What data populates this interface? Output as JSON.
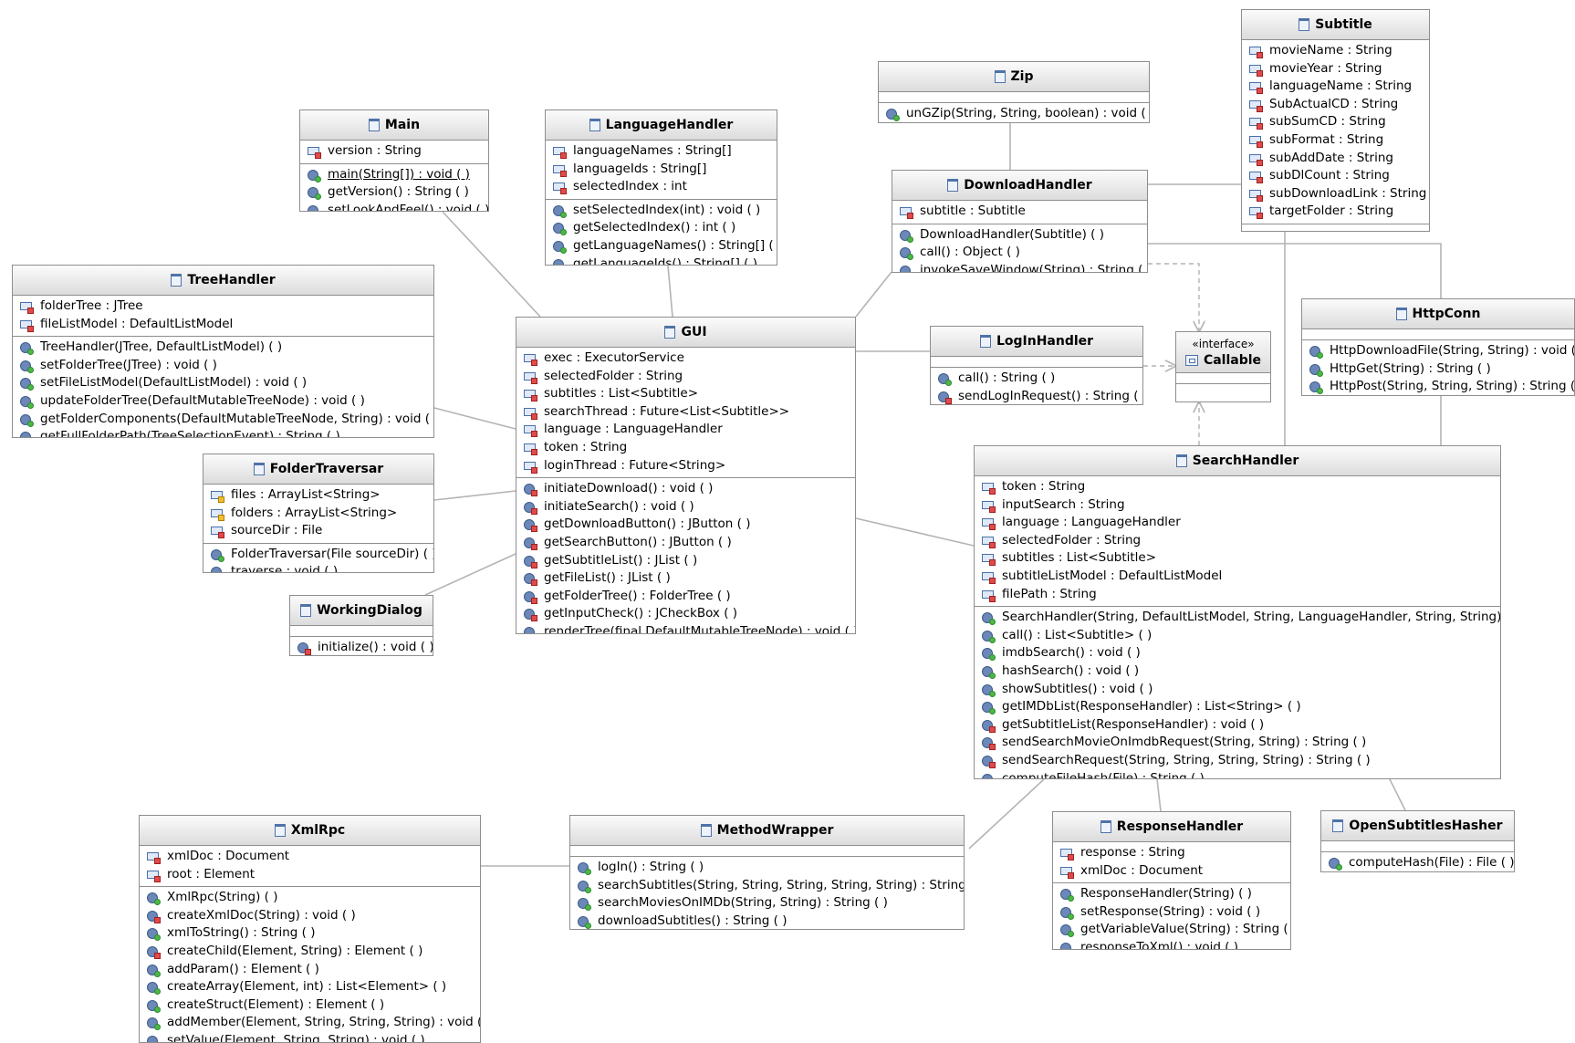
{
  "classes": [
    {
      "id": "main",
      "name": "Main",
      "fields": [
        {
          "text": "version : String",
          "vis": "priv"
        }
      ],
      "methods": [
        {
          "text": "main(String[]) : void ( )",
          "vis": "pub",
          "static": true
        },
        {
          "text": "getVersion() : String ( )",
          "vis": "pub"
        },
        {
          "text": "setLookAndFeel() : void ( )",
          "vis": "priv"
        }
      ]
    },
    {
      "id": "languagehandler",
      "name": "LanguageHandler",
      "fields": [
        {
          "text": "languageNames : String[]",
          "vis": "priv"
        },
        {
          "text": "languageIds : String[]",
          "vis": "priv"
        },
        {
          "text": "selectedIndex : int",
          "vis": "priv"
        }
      ],
      "methods": [
        {
          "text": "setSelectedIndex(int) : void ( )",
          "vis": "pub"
        },
        {
          "text": "getSelectedIndex() : int ( )",
          "vis": "pub"
        },
        {
          "text": "getLanguageNames() : String[] ( )",
          "vis": "pub"
        },
        {
          "text": "getLanguageIds() : String[] ( )",
          "vis": "pub"
        }
      ]
    },
    {
      "id": "zip",
      "name": "Zip",
      "fields": [],
      "methods": [
        {
          "text": "unGZip(String, String, boolean) : void ( )",
          "vis": "pub"
        }
      ]
    },
    {
      "id": "subtitle",
      "name": "Subtitle",
      "fields": [
        {
          "text": "movieName : String",
          "vis": "priv"
        },
        {
          "text": "movieYear : String",
          "vis": "priv"
        },
        {
          "text": "languageName : String",
          "vis": "priv"
        },
        {
          "text": "SubActualCD : String",
          "vis": "priv"
        },
        {
          "text": "subSumCD : String",
          "vis": "priv"
        },
        {
          "text": "subFormat : String",
          "vis": "priv"
        },
        {
          "text": "subAddDate : String",
          "vis": "priv"
        },
        {
          "text": "subDlCount : String",
          "vis": "priv"
        },
        {
          "text": "subDownloadLink : String",
          "vis": "priv"
        },
        {
          "text": "targetFolder : String",
          "vis": "priv"
        }
      ],
      "methods": []
    },
    {
      "id": "downloadhandler",
      "name": "DownloadHandler",
      "fields": [
        {
          "text": "subtitle : Subtitle",
          "vis": "priv"
        }
      ],
      "methods": [
        {
          "text": "DownloadHandler(Subtitle) ( )",
          "vis": "pub"
        },
        {
          "text": "call() : Object ( )",
          "vis": "pub"
        },
        {
          "text": "invokeSaveWindow(String) : String ( )",
          "vis": "priv"
        }
      ]
    },
    {
      "id": "treehandler",
      "name": "TreeHandler",
      "fields": [
        {
          "text": "folderTree : JTree",
          "vis": "priv"
        },
        {
          "text": "fileListModel : DefaultListModel",
          "vis": "priv"
        }
      ],
      "methods": [
        {
          "text": "TreeHandler(JTree, DefaultListModel) ( )",
          "vis": "pub"
        },
        {
          "text": "setFolderTree(JTree) : void ( )",
          "vis": "pub"
        },
        {
          "text": "setFileListModel(DefaultListModel) : void ( )",
          "vis": "pub"
        },
        {
          "text": "updateFolderTree(DefaultMutableTreeNode) : void ( )",
          "vis": "pub"
        },
        {
          "text": "getFolderComponents(DefaultMutableTreeNode, String) : void ( )",
          "vis": "pub"
        },
        {
          "text": "getFullFolderPath(TreeSelectionEvent) : String ( )",
          "vis": "pub"
        }
      ]
    },
    {
      "id": "gui",
      "name": "GUI",
      "fields": [
        {
          "text": "exec : ExecutorService",
          "vis": "priv"
        },
        {
          "text": "selectedFolder : String",
          "vis": "priv"
        },
        {
          "text": "subtitles : List<Subtitle>",
          "vis": "priv"
        },
        {
          "text": "searchThread : Future<List<Subtitle>>",
          "vis": "priv"
        },
        {
          "text": "language : LanguageHandler",
          "vis": "priv"
        },
        {
          "text": "token : String",
          "vis": "priv"
        },
        {
          "text": "loginThread : Future<String>",
          "vis": "priv"
        }
      ],
      "methods": [
        {
          "text": "initiateDownload() : void ( )",
          "vis": "priv"
        },
        {
          "text": "initiateSearch() : void ( )",
          "vis": "priv"
        },
        {
          "text": "getDownloadButton() : JButton ( )",
          "vis": "priv"
        },
        {
          "text": "getSearchButton() : JButton ( )",
          "vis": "priv"
        },
        {
          "text": "getSubtitleList() : JList ( )",
          "vis": "priv"
        },
        {
          "text": "getFileList() : JList ( )",
          "vis": "priv"
        },
        {
          "text": "getFolderTree() : FolderTree ( )",
          "vis": "priv"
        },
        {
          "text": "getInputCheck() : JCheckBox ( )",
          "vis": "priv"
        },
        {
          "text": "renderTree(final DefaultMutableTreeNode) : void ( )",
          "vis": "priv"
        }
      ]
    },
    {
      "id": "loginhandler",
      "name": "LogInHandler",
      "fields": [],
      "methods": [
        {
          "text": "call() : String ( )",
          "vis": "pub"
        },
        {
          "text": "sendLogInRequest() : String ( )",
          "vis": "priv"
        }
      ]
    },
    {
      "id": "callable",
      "name": "Callable",
      "stereotype": "«interface»",
      "fields": [],
      "methods": []
    },
    {
      "id": "httpconn",
      "name": "HttpConn",
      "fields": [],
      "methods": [
        {
          "text": "HttpDownloadFile(String, String) : void ( )",
          "vis": "pub"
        },
        {
          "text": "HttpGet(String) : String ( )",
          "vis": "pub"
        },
        {
          "text": "HttpPost(String, String, String) : String ( )",
          "vis": "pub"
        }
      ]
    },
    {
      "id": "foldertraversar",
      "name": "FolderTraversar",
      "fields": [
        {
          "text": "files : ArrayList<String>",
          "vis": "prot"
        },
        {
          "text": "folders : ArrayList<String>",
          "vis": "prot"
        },
        {
          "text": "sourceDir : File",
          "vis": "priv"
        }
      ],
      "methods": [
        {
          "text": "FolderTraversar(File sourceDir) ( )",
          "vis": "pub"
        },
        {
          "text": "traverse : void ( )",
          "vis": "pub"
        }
      ]
    },
    {
      "id": "workingdialog",
      "name": "WorkingDialog",
      "fields": [],
      "methods": [
        {
          "text": "initialize() : void ( )",
          "vis": "priv"
        }
      ]
    },
    {
      "id": "searchhandler",
      "name": "SearchHandler",
      "fields": [
        {
          "text": "token : String",
          "vis": "priv"
        },
        {
          "text": "inputSearch : String",
          "vis": "priv"
        },
        {
          "text": "language : LanguageHandler",
          "vis": "priv"
        },
        {
          "text": "selectedFolder : String",
          "vis": "priv"
        },
        {
          "text": "subtitles : List<Subtitle>",
          "vis": "priv"
        },
        {
          "text": "subtitleListModel : DefaultListModel",
          "vis": "priv"
        },
        {
          "text": "filePath : String",
          "vis": "priv"
        }
      ],
      "methods": [
        {
          "text": "SearchHandler(String, DefaultListModel, String, LanguageHandler, String, String) ( )",
          "vis": "pub"
        },
        {
          "text": "call() : List<Subtitle> ( )",
          "vis": "pub"
        },
        {
          "text": "imdbSearch() : void ( )",
          "vis": "pub"
        },
        {
          "text": "hashSearch() : void ( )",
          "vis": "pub"
        },
        {
          "text": "showSubtitles() : void ( )",
          "vis": "pub"
        },
        {
          "text": "getIMDbList(ResponseHandler) : List<String> ( )",
          "vis": "pub"
        },
        {
          "text": "getSubtitleList(ResponseHandler) : void ( )",
          "vis": "priv"
        },
        {
          "text": "sendSearchMovieOnImdbRequest(String, String) : String ( )",
          "vis": "priv"
        },
        {
          "text": "sendSearchRequest(String, String, String, String) : String ( )",
          "vis": "priv"
        },
        {
          "text": "computeFileHash(File) : String ( )",
          "vis": "priv"
        }
      ]
    },
    {
      "id": "xmlrpc",
      "name": "XmlRpc",
      "fields": [
        {
          "text": "xmlDoc : Document",
          "vis": "priv"
        },
        {
          "text": "root : Element",
          "vis": "priv"
        }
      ],
      "methods": [
        {
          "text": "XmlRpc(String) ( )",
          "vis": "pub"
        },
        {
          "text": "createXmlDoc(String) : void ( )",
          "vis": "priv"
        },
        {
          "text": "xmlToString() : String ( )",
          "vis": "pub"
        },
        {
          "text": "createChild(Element, String) : Element ( )",
          "vis": "priv"
        },
        {
          "text": "addParam() : Element ( )",
          "vis": "pub"
        },
        {
          "text": "createArray(Element, int) : List<Element> ( )",
          "vis": "pub"
        },
        {
          "text": "createStruct(Element) : Element ( )",
          "vis": "pub"
        },
        {
          "text": "addMember(Element, String, String, String) : void ( )",
          "vis": "pub"
        },
        {
          "text": "setValue(Element, String, String) : void ( )",
          "vis": "pub"
        }
      ]
    },
    {
      "id": "methodwrapper",
      "name": "MethodWrapper",
      "fields": [],
      "methods": [
        {
          "text": "logIn() : String ( )",
          "vis": "pub"
        },
        {
          "text": "searchSubtitles(String, String, String, String, String) : String ( )",
          "vis": "pub"
        },
        {
          "text": "searchMoviesOnIMDb(String, String) : String ( )",
          "vis": "pub"
        },
        {
          "text": "downloadSubtitles() : String ( )",
          "vis": "pub"
        }
      ]
    },
    {
      "id": "responsehandler",
      "name": "ResponseHandler",
      "fields": [
        {
          "text": "response : String",
          "vis": "priv"
        },
        {
          "text": "xmlDoc : Document",
          "vis": "priv"
        }
      ],
      "methods": [
        {
          "text": "ResponseHandler(String) ( )",
          "vis": "pub"
        },
        {
          "text": "setResponse(String) : void ( )",
          "vis": "pub"
        },
        {
          "text": "getVariableValue(String) : String ( )",
          "vis": "pub"
        },
        {
          "text": "responseToXml() : void ( )",
          "vis": "priv"
        }
      ]
    },
    {
      "id": "opensubtitleshasher",
      "name": "OpenSubtitlesHasher",
      "fields": [],
      "methods": [
        {
          "text": "computeHash(File) : File ( )",
          "vis": "pub"
        }
      ]
    }
  ],
  "colors": {
    "line": "#b4b4b4",
    "border": "#8e8e8e",
    "header": "#dcdcdc"
  }
}
